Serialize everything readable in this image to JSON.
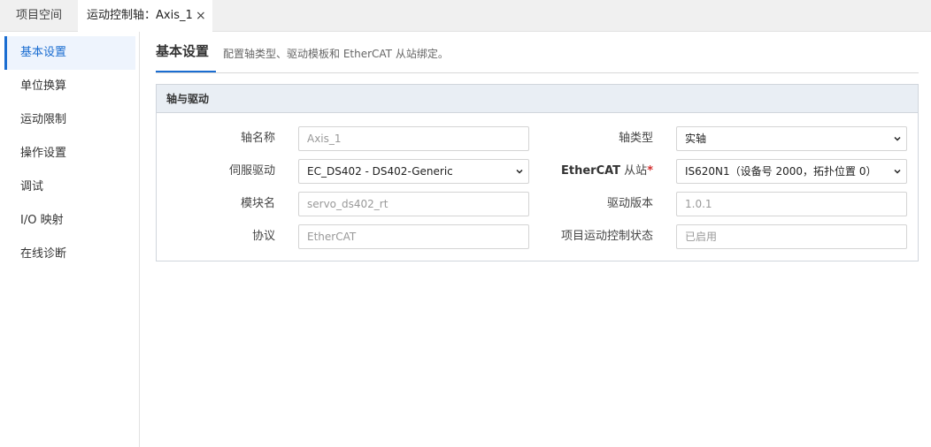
{
  "tabs": [
    {
      "label": "项目空间"
    },
    {
      "label": "运动控制轴：Axis_1",
      "close": "×"
    }
  ],
  "sidebar": {
    "items": [
      {
        "label": "基本设置",
        "active": true
      },
      {
        "label": "单位换算"
      },
      {
        "label": "运动限制"
      },
      {
        "label": "操作设置"
      },
      {
        "label": "调试"
      },
      {
        "label": "I/O 映射"
      },
      {
        "label": "在线诊断"
      }
    ]
  },
  "header": {
    "title": "基本设置",
    "description": "配置轴类型、驱动模板和 EtherCAT 从站绑定。"
  },
  "panel": {
    "title": "轴与驱动",
    "fields": {
      "axis_name": {
        "label": "轴名称",
        "value": "Axis_1"
      },
      "axis_type": {
        "label": "轴类型",
        "value": "实轴"
      },
      "servo_drive": {
        "label": "伺服驱动",
        "value": "EC_DS402 - DS402-Generic"
      },
      "ethercat_slave": {
        "label_bold": "EtherCAT",
        "label_rest": " 从站",
        "required": "*",
        "value": "IS620N1（设备号 2000，拓扑位置 0）"
      },
      "module_name": {
        "label": "模块名",
        "value": "servo_ds402_rt"
      },
      "driver_version": {
        "label": "驱动版本",
        "value": "1.0.1"
      },
      "protocol": {
        "label": "协议",
        "value": "EtherCAT"
      },
      "motion_status": {
        "label": "项目运动控制状态",
        "value": "已启用"
      }
    }
  },
  "colors": {
    "accent": "#1a6dd1",
    "required": "#d32f2f",
    "panel_header_bg": "#e9eef4"
  }
}
